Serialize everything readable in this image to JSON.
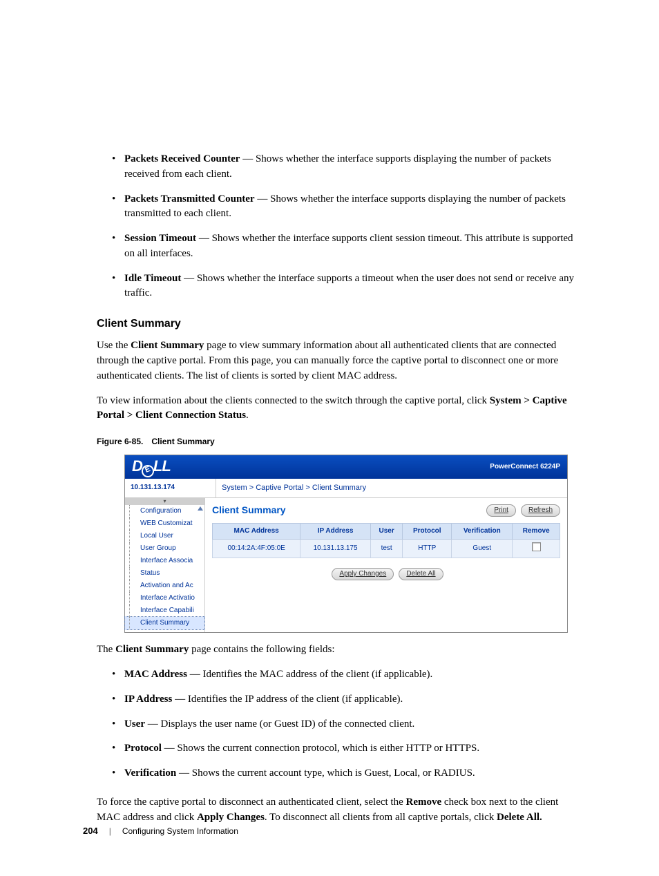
{
  "bullets_top": [
    {
      "term": "Packets Received Counter",
      "desc": " — Shows whether the interface supports displaying the number of packets received from each client."
    },
    {
      "term": "Packets Transmitted Counter",
      "desc": " — Shows whether the interface supports displaying the number of packets transmitted to each client."
    },
    {
      "term": "Session Timeout",
      "desc": " — Shows whether the interface supports client session timeout. This attribute is supported on all interfaces."
    },
    {
      "term": "Idle Timeout",
      "desc": " — Shows whether the interface supports a timeout when the user does not send or receive any traffic."
    }
  ],
  "section_heading": "Client Summary",
  "para1_pre": "Use the ",
  "para1_bold": "Client Summary",
  "para1_post": " page to view summary information about all authenticated clients that are connected through the captive portal. From this page, you can manually force the captive portal to disconnect one or more authenticated clients. The list of clients is sorted by client MAC address.",
  "para2_pre": "To view information about the clients connected to the switch through the captive portal, click ",
  "para2_bold": "System > Captive Portal > Client Connection Status",
  "para2_post": ".",
  "fig_label": "Figure 6-85.",
  "fig_title": "Client Summary",
  "shot": {
    "logo": "DELL",
    "model": "PowerConnect 6224P",
    "ip": "10.131.13.174",
    "breadcrumb": "System > Captive Portal > Client Summary",
    "nav": [
      "Configuration",
      "WEB Customizat",
      "Local User",
      "User Group",
      "Interface Associa",
      "Status",
      "Activation and Ac",
      "Interface Activatio",
      "Interface Capabili",
      "Client Summary"
    ],
    "title": "Client Summary",
    "print": "Print",
    "refresh": "Refresh",
    "headers": [
      "MAC Address",
      "IP Address",
      "User",
      "Protocol",
      "Verification",
      "Remove"
    ],
    "row": {
      "mac": "00:14:2A:4F:05:0E",
      "ip": "10.131.13.175",
      "user": "test",
      "proto": "HTTP",
      "ver": "Guest"
    },
    "apply": "Apply Changes",
    "delete": "Delete All"
  },
  "para3_pre": "The ",
  "para3_bold": "Client Summary",
  "para3_post": " page contains the following fields:",
  "bullets_bottom": [
    {
      "term": "MAC Address",
      "desc": " — Identifies the MAC address of the client (if applicable)."
    },
    {
      "term": "IP Address",
      "desc": " — Identifies the IP address of the client (if applicable)."
    },
    {
      "term": "User",
      "desc": " — Displays the user name (or Guest ID) of the connected client."
    },
    {
      "term": "Protocol",
      "desc": " — Shows the current connection protocol, which is either HTTP or HTTPS."
    },
    {
      "term": "Verification",
      "desc": " — Shows the current account type, which is Guest, Local, or RADIUS."
    }
  ],
  "para4_pre": "To force the captive portal to disconnect an authenticated client, select the ",
  "para4_b1": "Remove",
  "para4_mid": " check box next to the client MAC address and click ",
  "para4_b2": "Apply Changes",
  "para4_mid2": ". To disconnect all clients from all captive portals, click ",
  "para4_b3": "Delete All.",
  "footer": {
    "page": "204",
    "chapter": "Configuring System Information"
  }
}
